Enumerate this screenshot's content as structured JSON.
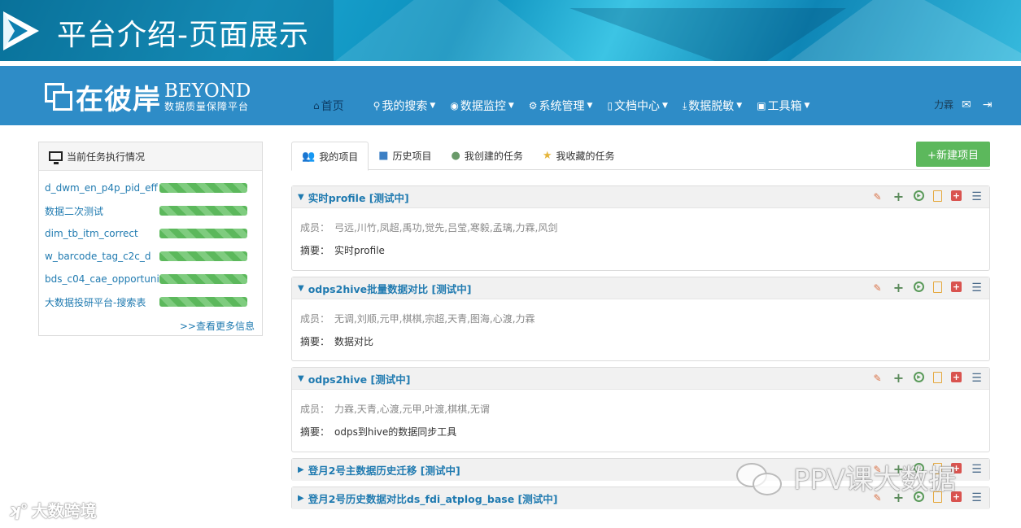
{
  "banner": {
    "title": "平台介绍-页面展示"
  },
  "brand": {
    "cn": "在彼岸",
    "en": "BEYOND",
    "sub": "数据质量保障平台"
  },
  "nav": {
    "items": [
      {
        "icon": "home-icon",
        "label": "首页"
      },
      {
        "icon": "search-icon",
        "label": "我的搜索"
      },
      {
        "icon": "eye-icon",
        "label": "数据监控"
      },
      {
        "icon": "gear-icon",
        "label": "系统管理"
      },
      {
        "icon": "document-icon",
        "label": "文档中心"
      },
      {
        "icon": "download-icon",
        "label": "数据脱敏"
      },
      {
        "icon": "toolbox-icon",
        "label": "工具箱"
      }
    ],
    "user": "力霖"
  },
  "left_panel": {
    "title": "当前任务执行情况",
    "tasks": [
      {
        "name": "d_dwm_en_p4p_pid_eff",
        "progress": 1.0
      },
      {
        "name": "数据二次测试",
        "progress": 1.0
      },
      {
        "name": "dim_tb_itm_correct",
        "progress": 1.0
      },
      {
        "name": "w_barcode_tag_c2c_d",
        "progress": 1.0
      },
      {
        "name": "bds_c04_cae_opportuni",
        "progress": 1.0
      },
      {
        "name": "大数据投研平台-搜索表",
        "progress": 1.0
      }
    ],
    "more": ">>查看更多信息"
  },
  "tabs": [
    {
      "icon": "users-icon",
      "label": "我的项目",
      "active": true
    },
    {
      "icon": "folder-icon",
      "label": "历史项目",
      "active": false
    },
    {
      "icon": "user-icon",
      "label": "我创建的任务",
      "active": false
    },
    {
      "icon": "star-icon",
      "label": "我收藏的任务",
      "active": false
    }
  ],
  "new_project_label": "+新建项目",
  "projects": [
    {
      "title": "实时profile [测试中]",
      "members_label": "成员：",
      "members": "弓远,川竹,凤超,禹功,觉先,吕莹,寒毅,孟璃,力霖,风剑",
      "summary_label": "摘要：",
      "summary": "实时profile",
      "expanded": true
    },
    {
      "title": "odps2hive批量数据对比 [测试中]",
      "members_label": "成员：",
      "members": "无调,刘顺,元甲,棋棋,宗超,天青,图海,心渡,力霖",
      "summary_label": "摘要：",
      "summary": "数据对比",
      "expanded": true
    },
    {
      "title": "odps2hive [测试中]",
      "members_label": "成员：",
      "members": "力霖,天青,心渡,元甲,叶渡,棋棋,无谓",
      "summary_label": "摘要：",
      "summary": "odps到hive的数据同步工具",
      "expanded": true
    },
    {
      "title": "登月2号主数据历史迁移 [测试中]",
      "expanded": false
    },
    {
      "title": "登月2号历史数据对比ds_fdi_atplog_base [测试中]",
      "expanded": false
    }
  ],
  "watermarks": {
    "left": "大数跨境",
    "right": "PPV课大数据"
  }
}
